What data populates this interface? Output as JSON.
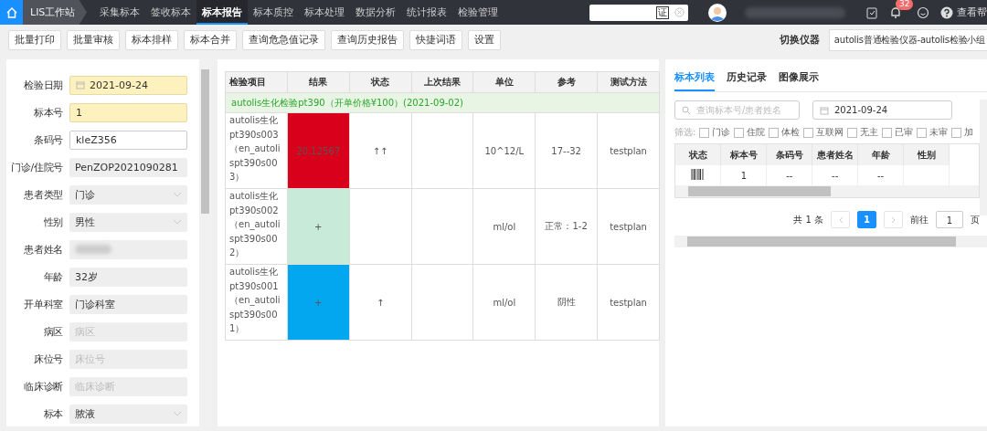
{
  "topbar": {
    "app_title": "LIS工作站",
    "nav": [
      {
        "label": "采集标本",
        "selected": false
      },
      {
        "label": "签收标本",
        "selected": false
      },
      {
        "label": "标本报告",
        "selected": true
      },
      {
        "label": "标本质控",
        "selected": false
      },
      {
        "label": "标本处理",
        "selected": false
      },
      {
        "label": "数据分析",
        "selected": false
      },
      {
        "label": "统计报表",
        "selected": false
      },
      {
        "label": "检验管理",
        "selected": false
      }
    ],
    "search_key": "证",
    "user_name_redacted": true,
    "notification_count": "32",
    "help": "查看帮"
  },
  "toolbar": {
    "buttons": [
      "批量打印",
      "批量审核",
      "标本排样",
      "标本合并",
      "查询危急值记录",
      "查询历史报告",
      "快捷词语",
      "设置"
    ],
    "switch_label": "切换仪器",
    "instrument": "autolis普通检验仪器-autolis检验小组"
  },
  "form": [
    {
      "label": "检验日期",
      "kind": "date",
      "value": "2021-09-24",
      "highlighted": true
    },
    {
      "label": "标本号",
      "kind": "input",
      "value": "1",
      "highlighted": true
    },
    {
      "label": "条码号",
      "kind": "input",
      "value": "kleZ356",
      "highlighted": false
    },
    {
      "label": "门诊/住院号",
      "kind": "readonly",
      "value": "PenZOP2021090281",
      "highlighted": false
    },
    {
      "label": "患者类型",
      "kind": "select",
      "value": "门诊",
      "highlighted": false
    },
    {
      "label": "性别",
      "kind": "select",
      "value": "男性",
      "highlighted": false
    },
    {
      "label": "患者姓名",
      "kind": "redacted",
      "highlighted": false
    },
    {
      "label": "年龄",
      "kind": "readonly",
      "value": "32岁",
      "highlighted": false
    },
    {
      "label": "开单科室",
      "kind": "readonly",
      "value": "门诊科室",
      "highlighted": false
    },
    {
      "label": "病区",
      "kind": "readonly",
      "placeholder": "病区",
      "highlighted": false
    },
    {
      "label": "床位号",
      "kind": "readonly",
      "placeholder": "床位号",
      "highlighted": false
    },
    {
      "label": "临床诊断",
      "kind": "readonly",
      "placeholder": "临床诊断",
      "highlighted": false
    },
    {
      "label": "标本",
      "kind": "select",
      "value": "脓液",
      "highlighted": false
    }
  ],
  "results": {
    "columns": [
      "检验项目",
      "结果",
      "状态",
      "上次结果",
      "单位",
      "参考",
      "测试方法"
    ],
    "group": "autolis生化检验pt390（开单价格¥100）(2021-09-02)",
    "rows": [
      {
        "item": "autolis生化pt390s003（en_autolispt390s003）",
        "result": "20.12567",
        "color": "#d9001b",
        "status": "↑↑",
        "unit": "10^12/L",
        "reference": "17--32",
        "method": "testplan"
      },
      {
        "item": "autolis生化pt390s002（en_autolispt390s002）",
        "result": "+",
        "color": "#c8ebd9",
        "unit": "ml/ol",
        "reference": "正常：1-2",
        "method": "testplan"
      },
      {
        "item": "autolis生化pt390s001（en_autolispt390s001）",
        "result": "+",
        "color": "#02a7f0",
        "status": "↑",
        "unit": "ml/ol",
        "reference": "阴性",
        "method": "testplan"
      }
    ]
  },
  "side": {
    "tabs": [
      {
        "label": "标本列表",
        "selected": true
      },
      {
        "label": "历史记录",
        "selected": false
      },
      {
        "label": "图像展示",
        "selected": false
      }
    ],
    "search_placeholder": "查询标本号/患者姓名",
    "date": "2021-09-24",
    "filter_label": "筛选:",
    "filters": [
      {
        "label": "门诊",
        "checked": false
      },
      {
        "label": "住院",
        "checked": false
      },
      {
        "label": "体检",
        "checked": false
      },
      {
        "label": "互联网",
        "checked": false
      },
      {
        "label": "无主",
        "checked": false
      },
      {
        "label": "已审",
        "checked": false
      },
      {
        "label": "未审",
        "checked": false
      },
      {
        "label": "加",
        "checked": false
      }
    ],
    "columns": [
      "状态",
      "标本号",
      "条码号",
      "患者姓名",
      "年龄",
      "性别"
    ],
    "rows": [
      {
        "specimen_no": "1",
        "barcode": "--",
        "patient": "--",
        "age": "--"
      }
    ],
    "total": "共 1 条",
    "pages": [
      {
        "label": "1",
        "selected": true
      }
    ],
    "goto_label": "前往",
    "goto_value": "1",
    "page_unit": "页"
  }
}
